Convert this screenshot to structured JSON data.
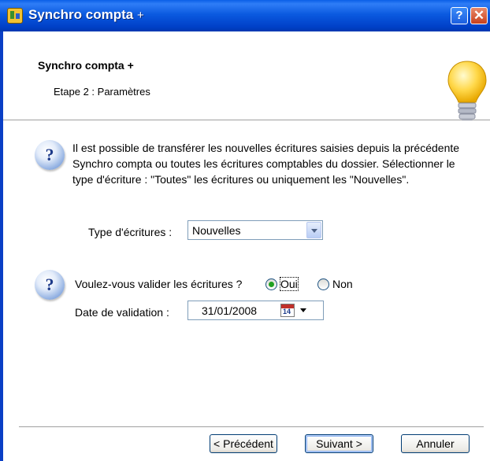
{
  "window": {
    "title": "Synchro compta",
    "title_suffix": "+",
    "help_button": "?",
    "close_button": "✕"
  },
  "header": {
    "title": "Synchro compta +",
    "subtitle": "Etape 2 : Paramètres",
    "icon": "lightbulb-icon"
  },
  "info": {
    "text": "Il est possible de transférer les nouvelles écritures saisies depuis la précédente Synchro compta ou toutes les écritures comptables du dossier. Sélectionner le type d'écriture : \"Toutes\" les écritures ou uniquement les \"Nouvelles\".",
    "type_label": "Type d'écritures :",
    "type_value": "Nouvelles"
  },
  "validation": {
    "question": "Voulez-vous valider les écritures ?",
    "option_yes": "Oui",
    "option_no": "Non",
    "selected": "Oui",
    "date_label": "Date de validation :",
    "date_value": "31/01/2008",
    "calendar_day": "14"
  },
  "buttons": {
    "previous": "< Précédent",
    "next": "Suivant >",
    "cancel": "Annuler"
  },
  "colors": {
    "titlebar": "#0a5fe8",
    "radio_selected": "#21a121"
  }
}
